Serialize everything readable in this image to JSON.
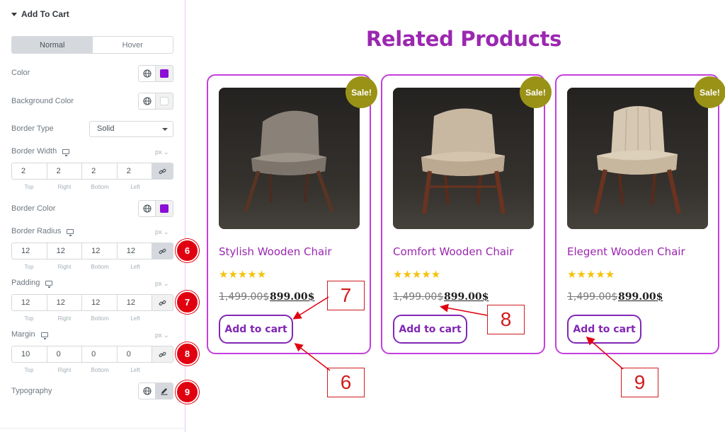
{
  "panel": {
    "section_title": "Add To Cart",
    "tabs": [
      {
        "label": "Normal",
        "active": true
      },
      {
        "label": "Hover",
        "active": false
      }
    ],
    "color_label": "Color",
    "color_value": "#8a0fd6",
    "background_color_label": "Background Color",
    "background_color_value": "#ffffff",
    "border_type_label": "Border Type",
    "border_type_value": "Solid",
    "border_width": {
      "label": "Border Width",
      "unit": "px",
      "top": "2",
      "right": "2",
      "bottom": "2",
      "left": "2"
    },
    "border_color_label": "Border Color",
    "border_color_value": "#8a0fd6",
    "border_radius": {
      "label": "Border Radius",
      "unit": "px",
      "top": "12",
      "right": "12",
      "bottom": "12",
      "left": "12"
    },
    "padding": {
      "label": "Padding",
      "unit": "px",
      "top": "12",
      "right": "12",
      "bottom": "12",
      "left": "12"
    },
    "margin": {
      "label": "Margin",
      "unit": "px",
      "top": "10",
      "right": "0",
      "bottom": "0",
      "left": "0"
    },
    "typography_label": "Typography",
    "captions": {
      "top": "Top",
      "right": "Right",
      "bottom": "Bottom",
      "left": "Left"
    }
  },
  "badges": [
    "6",
    "7",
    "8",
    "9"
  ],
  "preview": {
    "heading": "Related Products",
    "products": [
      {
        "title": "Stylish Wooden Chair",
        "sale": "Sale!",
        "stars": "★★★★★",
        "old_price": "1,499.00$",
        "new_price": "899.00$",
        "button": "Add to cart"
      },
      {
        "title": "Comfort Wooden Chair",
        "sale": "Sale!",
        "stars": "★★★★★",
        "old_price": "1,499.00$",
        "new_price": "899.00$",
        "button": "Add to cart"
      },
      {
        "title": "Elegent Wooden Chair",
        "sale": "Sale!",
        "stars": "★★★★★",
        "old_price": "1,499.00$",
        "new_price": "899.00$",
        "button": "Add to cart"
      }
    ]
  },
  "callouts": [
    "7",
    "8",
    "6",
    "9"
  ],
  "colors": {
    "accent": "#9b27b0",
    "button": "#8127b5",
    "badge": "#e0000f",
    "sale": "#9a9217",
    "star": "#f4c20d"
  }
}
